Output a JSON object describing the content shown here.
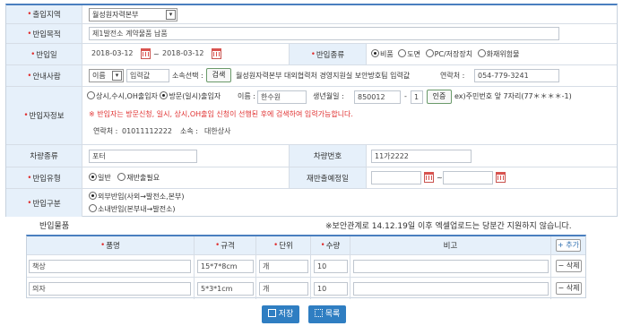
{
  "form": {
    "destination": {
      "label": "출입지역",
      "value": "월성원자력본부"
    },
    "purpose": {
      "label": "반입목적",
      "value": "제1발전소 계약물품 납품"
    },
    "date": {
      "label": "반입일",
      "from": "2018-03-12",
      "sep": "~",
      "to": "2018-03-12"
    },
    "kind": {
      "label": "반입종류",
      "options": [
        "비품",
        "도면",
        "PC/저장장치",
        "화재위험물"
      ],
      "selected": 0
    },
    "guide": {
      "label": "안내사람",
      "type_value": "이름",
      "name_placeholder": "입력값",
      "dept_label": "소속선택 :",
      "search": "검색",
      "dept_value": "월성원자력본부 대외협력처 경영지원실 보안방호팀 입력값",
      "contact_label": "연락처 :",
      "contact_value": "054-779-3241"
    },
    "person": {
      "label": "반입자정보",
      "type_options": [
        "상시,수시,OH출입자",
        "방문(일시)출입자"
      ],
      "type_selected": 1,
      "name_label": "이름 :",
      "name_value": "한수원",
      "birth_label": "생년월일 :",
      "birth_value": "850012",
      "birth_sep": "-",
      "birth_suffix": "1",
      "verify": "인증",
      "example": "ex)주민번호 앞 7자리(77＊＊＊＊-1)",
      "notice": "※ 반입자는 방문신청, 일시, 상시,OH출입 신청이 선행된 후에 검색하여 입력가능합니다.",
      "contact_label": "연락처 :",
      "contact_value": "01011112222",
      "org_label": "소속 :",
      "org_value": "대한상사"
    },
    "vehicle": {
      "label": "차량종류",
      "value": "포터",
      "plate_label": "차량번호",
      "plate_value": "11가2222"
    },
    "intype": {
      "label": "반입유형",
      "options": [
        "일반",
        "재반출필요"
      ],
      "selected": 0,
      "reexport_label": "재반출예정일",
      "reexport_sep": "~"
    },
    "category": {
      "label": "반입구분",
      "options": [
        "외부반입(사외→발전소,본부)",
        "소내반입(본부내→발전소)"
      ],
      "selected": 0
    }
  },
  "items": {
    "title": "반입물품",
    "notice": "※보안관계로 14.12.19일 이후 엑셀업로드는 당분간 지원하지 않습니다.",
    "headers": {
      "name": "품명",
      "spec": "규격",
      "unit": "단위",
      "qty": "수량",
      "note": "비고"
    },
    "add": "+ 추가",
    "rows": [
      {
        "name": "책상",
        "spec": "15*7*8cm",
        "unit": "개",
        "qty": "10",
        "note": "",
        "del": "− 삭제"
      },
      {
        "name": "의자",
        "spec": "5*3*1cm",
        "unit": "개",
        "qty": "10",
        "note": "",
        "del": "− 삭제"
      }
    ]
  },
  "buttons": {
    "save": "저장",
    "list": "목록"
  },
  "colors": {
    "accent": "#2f7ec2",
    "label_bg": "#e6f0fa",
    "required": "#e03030"
  }
}
